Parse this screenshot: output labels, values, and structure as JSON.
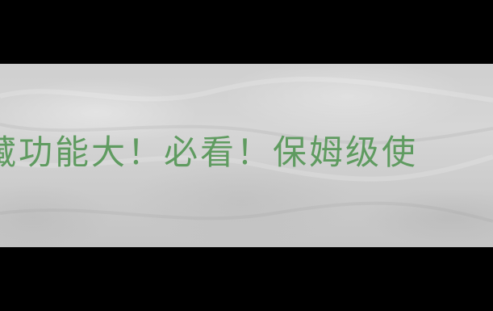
{
  "banner": {
    "headline": "藏功能大！必看！保姆级使",
    "text_color": "#5f9b60",
    "letterbox_color": "#000000",
    "background_color": "#d2d2d2"
  }
}
